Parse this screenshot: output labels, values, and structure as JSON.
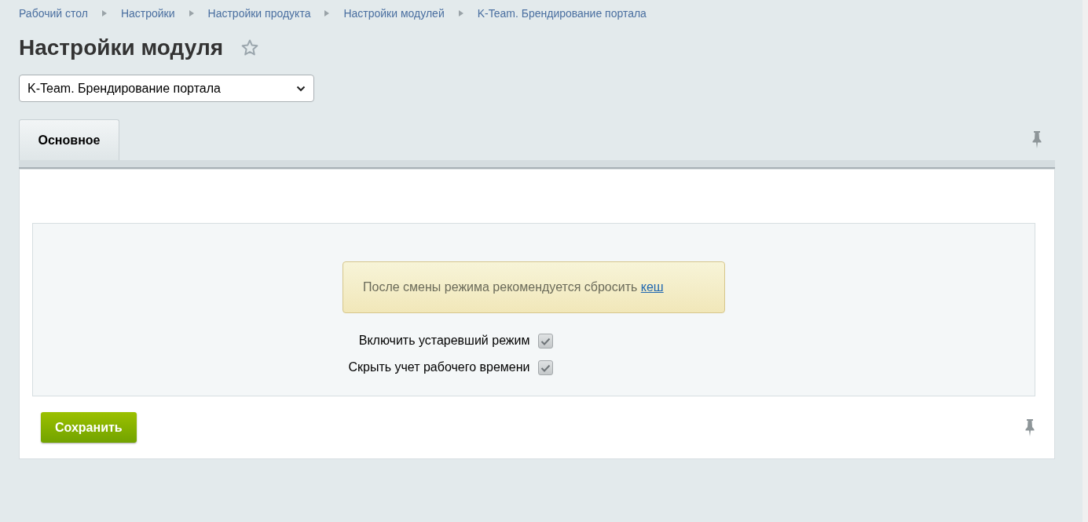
{
  "breadcrumbs": [
    "Рабочий стол",
    "Настройки",
    "Настройки продукта",
    "Настройки модулей",
    "K-Team. Брендирование портала"
  ],
  "title": "Настройки модуля",
  "favorite": {
    "on": false
  },
  "module_select": {
    "value": "K-Team. Брендирование портала"
  },
  "tabs": [
    {
      "label": "Основное",
      "selected": true
    }
  ],
  "notice": {
    "text": "После смены режима рекомендуется сбросить ",
    "link": "кеш"
  },
  "options": [
    {
      "label": "Включить устаревший режим",
      "checked": true
    },
    {
      "label": "Скрыть учет рабочего времени",
      "checked": true
    }
  ],
  "buttons": [
    "Сохранить"
  ]
}
